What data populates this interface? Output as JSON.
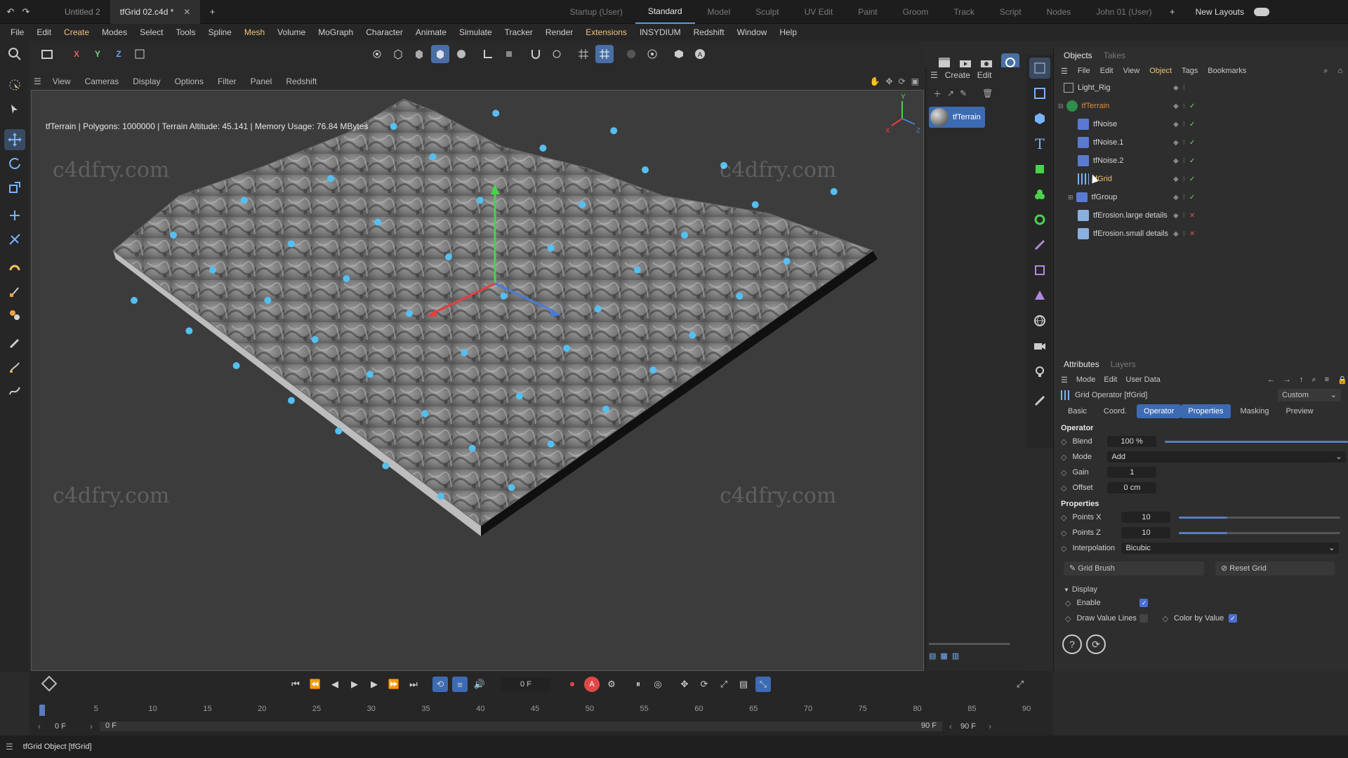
{
  "tabs": {
    "docs": [
      {
        "label": "Untitled 2"
      },
      {
        "label": "tfGrid 02.c4d *"
      }
    ],
    "layouts": [
      "Startup (User)",
      "Standard",
      "Model",
      "Sculpt",
      "UV Edit",
      "Paint",
      "Groom",
      "Track",
      "Script",
      "Nodes",
      "John 01 (User)"
    ],
    "new_layouts": "New Layouts"
  },
  "menu": [
    "File",
    "Edit",
    "Create",
    "Modes",
    "Select",
    "Tools",
    "Spline",
    "Mesh",
    "Volume",
    "MoGraph",
    "Character",
    "Animate",
    "Simulate",
    "Tracker",
    "Render",
    "Extensions",
    "INSYDIUM",
    "Redshift",
    "Window",
    "Help"
  ],
  "axis_tools": {
    "x": "X",
    "y": "Y",
    "z": "Z"
  },
  "viewport": {
    "menu": [
      "View",
      "Cameras",
      "Display",
      "Options",
      "Filter",
      "Panel",
      "Redshift"
    ],
    "info": "tfTerrain | Polygons: 1000000 | Terrain Altitude: 45.141 | Memory Usage: 76.84 MBytes",
    "watermarks": [
      "c4dfry.com",
      "c4dfry.com",
      "c4dfry.com",
      "c4dfry.com"
    ],
    "axis": {
      "x": "X",
      "y": "Y",
      "z": "Z"
    },
    "grid_points": [
      [
        0.38,
        0.05
      ],
      [
        0.51,
        0.02
      ],
      [
        0.66,
        0.06
      ],
      [
        0.8,
        0.14
      ],
      [
        0.94,
        0.2
      ],
      [
        0.1,
        0.3
      ],
      [
        0.19,
        0.22
      ],
      [
        0.3,
        0.17
      ],
      [
        0.43,
        0.12
      ],
      [
        0.57,
        0.1
      ],
      [
        0.7,
        0.15
      ],
      [
        0.84,
        0.23
      ],
      [
        0.05,
        0.45
      ],
      [
        0.15,
        0.38
      ],
      [
        0.25,
        0.32
      ],
      [
        0.36,
        0.27
      ],
      [
        0.49,
        0.22
      ],
      [
        0.62,
        0.23
      ],
      [
        0.75,
        0.3
      ],
      [
        0.88,
        0.36
      ],
      [
        0.12,
        0.52
      ],
      [
        0.22,
        0.45
      ],
      [
        0.32,
        0.4
      ],
      [
        0.45,
        0.35
      ],
      [
        0.58,
        0.33
      ],
      [
        0.69,
        0.38
      ],
      [
        0.82,
        0.44
      ],
      [
        0.18,
        0.6
      ],
      [
        0.28,
        0.54
      ],
      [
        0.4,
        0.48
      ],
      [
        0.52,
        0.44
      ],
      [
        0.64,
        0.47
      ],
      [
        0.76,
        0.53
      ],
      [
        0.25,
        0.68
      ],
      [
        0.35,
        0.62
      ],
      [
        0.47,
        0.57
      ],
      [
        0.6,
        0.56
      ],
      [
        0.71,
        0.61
      ],
      [
        0.31,
        0.75
      ],
      [
        0.42,
        0.71
      ],
      [
        0.54,
        0.67
      ],
      [
        0.65,
        0.7
      ],
      [
        0.37,
        0.83
      ],
      [
        0.48,
        0.79
      ],
      [
        0.58,
        0.78
      ],
      [
        0.44,
        0.9
      ],
      [
        0.53,
        0.88
      ]
    ]
  },
  "material": {
    "create": "Create",
    "edit": "Edit",
    "name": "tfTerrain"
  },
  "objects": {
    "tabs": [
      "Objects",
      "Takes"
    ],
    "menu": [
      "File",
      "Edit",
      "View",
      "Object",
      "Tags",
      "Bookmarks"
    ],
    "items": [
      {
        "name": "Light_Rig",
        "color": "#d4d4d4"
      },
      {
        "name": "tfTerrain",
        "color": "#e08a3a"
      },
      {
        "name": "tfNoise",
        "color": "#d4d4d4"
      },
      {
        "name": "tfNoise.1",
        "color": "#d4d4d4"
      },
      {
        "name": "tfNoise.2",
        "color": "#d4d4d4"
      },
      {
        "name": "tfGrid",
        "color": "#f0c060"
      },
      {
        "name": "tfGroup",
        "color": "#d4d4d4"
      },
      {
        "name": "tfErosion.large details",
        "color": "#d4d4d4"
      },
      {
        "name": "tfErosion.small details",
        "color": "#d4d4d4"
      }
    ]
  },
  "attributes": {
    "tabs": [
      "Attributes",
      "Layers"
    ],
    "menu": [
      "Mode",
      "Edit",
      "User Data"
    ],
    "title": "Grid Operator [tfGrid]",
    "preset": "Custom",
    "subtabs": [
      "Basic",
      "Coord.",
      "Operator",
      "Properties",
      "Masking",
      "Preview"
    ],
    "operator_heading": "Operator",
    "blend": {
      "label": "Blend",
      "value": "100 %",
      "fraction": 1.0
    },
    "mode": {
      "label": "Mode",
      "value": "Add"
    },
    "gain": {
      "label": "Gain",
      "value": "1"
    },
    "offset": {
      "label": "Offset",
      "value": "0 cm"
    },
    "properties_heading": "Properties",
    "points_x": {
      "label": "Points X",
      "value": "10",
      "fraction": 0.3
    },
    "points_z": {
      "label": "Points Z",
      "value": "10",
      "fraction": 0.3
    },
    "interpolation": {
      "label": "Interpolation",
      "value": "Bicubic"
    },
    "grid_brush": "Grid Brush",
    "reset_grid": "Reset Grid",
    "display_heading": "Display",
    "enable": {
      "label": "Enable",
      "checked": true
    },
    "draw_value_lines": {
      "label": "Draw Value Lines",
      "checked": false
    },
    "color_by_value": {
      "label": "Color by Value",
      "checked": true
    }
  },
  "timeline": {
    "current_frame": "0 F",
    "ticks": [
      "0",
      "5",
      "10",
      "15",
      "20",
      "25",
      "30",
      "35",
      "40",
      "45",
      "50",
      "55",
      "60",
      "65",
      "70",
      "75",
      "80",
      "85",
      "90"
    ],
    "start": "0 F",
    "range_start": "0 F",
    "end": "90 F",
    "end2": "90 F"
  },
  "status": "tfGrid Object [tfGrid]"
}
